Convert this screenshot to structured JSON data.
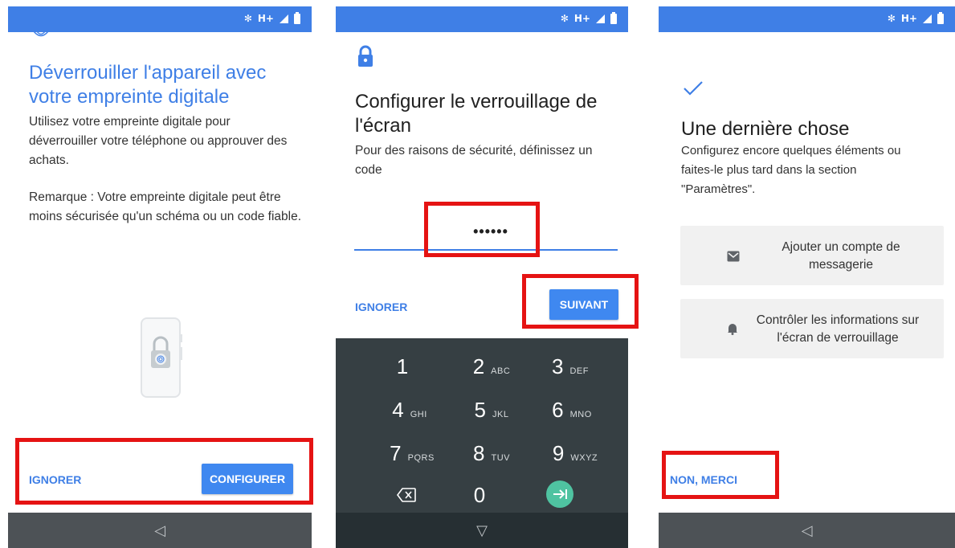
{
  "screens": {
    "fingerprint": {
      "title": "Déverrouiller l'appareil avec votre empreinte digitale",
      "description": "Utilisez votre empreinte digitale pour déverrouiller votre téléphone ou approuver des achats.",
      "note": "Remarque : Votre empreinte digitale peut être moins sécurisée qu'un schéma ou un code fiable.",
      "skip_label": "IGNORER",
      "configure_label": "CONFIGURER"
    },
    "screen_lock": {
      "title": "Configurer le verrouillage de l'écran",
      "description": "Pour des raisons de sécurité, définissez un code",
      "pin_value": "••••••",
      "skip_label": "IGNORER",
      "next_label": "SUIVANT",
      "keypad": [
        {
          "num": "1",
          "letters": ""
        },
        {
          "num": "2",
          "letters": "ABC"
        },
        {
          "num": "3",
          "letters": "DEF"
        },
        {
          "num": "4",
          "letters": "GHI"
        },
        {
          "num": "5",
          "letters": "JKL"
        },
        {
          "num": "6",
          "letters": "MNO"
        },
        {
          "num": "7",
          "letters": "PQRS"
        },
        {
          "num": "8",
          "letters": "TUV"
        },
        {
          "num": "9",
          "letters": "WXYZ"
        },
        {
          "num": "0",
          "letters": ""
        }
      ]
    },
    "last_thing": {
      "title": "Une dernière chose",
      "description": "Configurez encore quelques éléments ou faites-le plus tard dans la section \"Paramètres\".",
      "option_email": "Ajouter un compte de messagerie",
      "option_lockscreen": "Contrôler les informations sur l'écran de verrouillage",
      "no_thanks_label": "NON, MERCI"
    }
  },
  "status_bar": {
    "network": "H+"
  },
  "colors": {
    "accent": "#3f7fe6",
    "highlight": "#e51313",
    "keypad": "#363f43",
    "fab": "#4fc3a1"
  }
}
